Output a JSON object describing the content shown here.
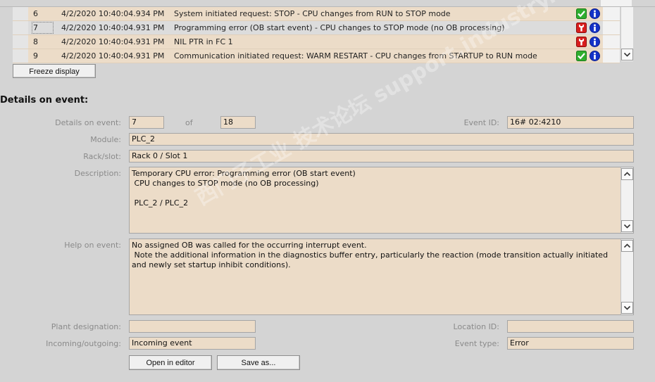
{
  "events": [
    {
      "num": "6",
      "timestamp": "4/2/2020 10:40:04.934 PM",
      "message": "System initiated request: STOP  - CPU changes from RUN to STOP mode",
      "status_icon": "green-check-icon",
      "selected": false
    },
    {
      "num": "7",
      "timestamp": "4/2/2020 10:40:04.931 PM",
      "message": "Programming error (OB start event)  - CPU changes to STOP mode (no OB processing)",
      "status_icon": "red-wrench-icon",
      "selected": true
    },
    {
      "num": "8",
      "timestamp": "4/2/2020 10:40:04.931 PM",
      "message": "NIL PTR in FC 1",
      "status_icon": "red-wrench-icon",
      "selected": false
    },
    {
      "num": "9",
      "timestamp": "4/2/2020 10:40:04.931 PM",
      "message": "Communication initiated request: WARM RESTART  - CPU changes from STARTUP to RUN mode",
      "status_icon": "green-check-icon",
      "selected": false
    }
  ],
  "freeze_button": "Freeze display",
  "details": {
    "title": "Details on event:",
    "event_label": "Details on event:",
    "event_num": "7",
    "of_label": "of",
    "event_total": "18",
    "event_id_label": "Event ID:",
    "event_id": "16# 02:4210",
    "module_label": "Module:",
    "module": "PLC_2",
    "rack_label": "Rack/slot:",
    "rack": "Rack 0 / Slot 1",
    "description_label": "Description:",
    "description": "Temporary CPU error: Programming error (OB start event)\n CPU changes to STOP mode (no OB processing)\n\n PLC_2 / PLC_2",
    "help_label": "Help on event:",
    "help": "No assigned OB was called for the occurring interrupt event.\n Note the additional information in the diagnostics buffer entry, particularly the reaction (mode transition actually initiated and newly set startup inhibit conditions).",
    "plant_label": "Plant designation:",
    "plant": "",
    "location_label": "Location ID:",
    "location": "",
    "incoming_label": "Incoming/outgoing:",
    "incoming": "Incoming event",
    "event_type_label": "Event type:",
    "event_type": "Error",
    "open_button": "Open in editor",
    "save_button": "Save as..."
  },
  "watermark": "西门子工业  技术论坛  support.industry.siemens.com/cs"
}
